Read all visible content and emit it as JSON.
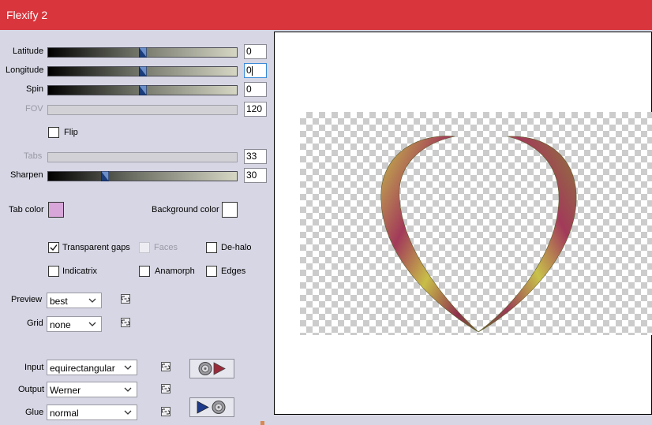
{
  "window": {
    "title": "Flexify 2"
  },
  "sliders": [
    {
      "label": "Latitude",
      "value": "0",
      "position": 0.5,
      "enabled": true,
      "focused": false
    },
    {
      "label": "Longitude",
      "value": "0",
      "position": 0.5,
      "enabled": true,
      "focused": true
    },
    {
      "label": "Spin",
      "value": "0",
      "position": 0.5,
      "enabled": true,
      "focused": false
    },
    {
      "label": "FOV",
      "value": "120",
      "position": 0.0,
      "enabled": false,
      "focused": false
    },
    {
      "label": "Tabs",
      "value": "33",
      "position": 0.0,
      "enabled": false,
      "focused": false
    },
    {
      "label": "Sharpen",
      "value": "30",
      "position": 0.3,
      "enabled": true,
      "focused": false
    }
  ],
  "flip": {
    "label": "Flip",
    "checked": false
  },
  "colors": {
    "tab_color_label": "Tab color",
    "tab_color": "#d8a6d8",
    "background_color_label": "Background color",
    "background_color": "#ffffff"
  },
  "options": {
    "transparent_gaps": {
      "label": "Transparent gaps",
      "checked": true
    },
    "faces": {
      "label": "Faces",
      "checked": false,
      "enabled": false
    },
    "de_halo": {
      "label": "De-halo",
      "checked": false
    },
    "indicatrix": {
      "label": "Indicatrix",
      "checked": false
    },
    "anamorph": {
      "label": "Anamorph",
      "checked": false
    },
    "edges": {
      "label": "Edges",
      "checked": false
    }
  },
  "preview": {
    "label": "Preview",
    "value": "best"
  },
  "grid": {
    "label": "Grid",
    "value": "none"
  },
  "input": {
    "label": "Input",
    "value": "equirectangular"
  },
  "output": {
    "label": "Output",
    "value": "Werner"
  },
  "glue": {
    "label": "Glue",
    "value": "normal"
  },
  "icons": {
    "lock": "link-lock-icon",
    "input_button": "globe-arrow-right-icon",
    "output_button": "arrow-globe-icon"
  },
  "accent": "#d8353c"
}
